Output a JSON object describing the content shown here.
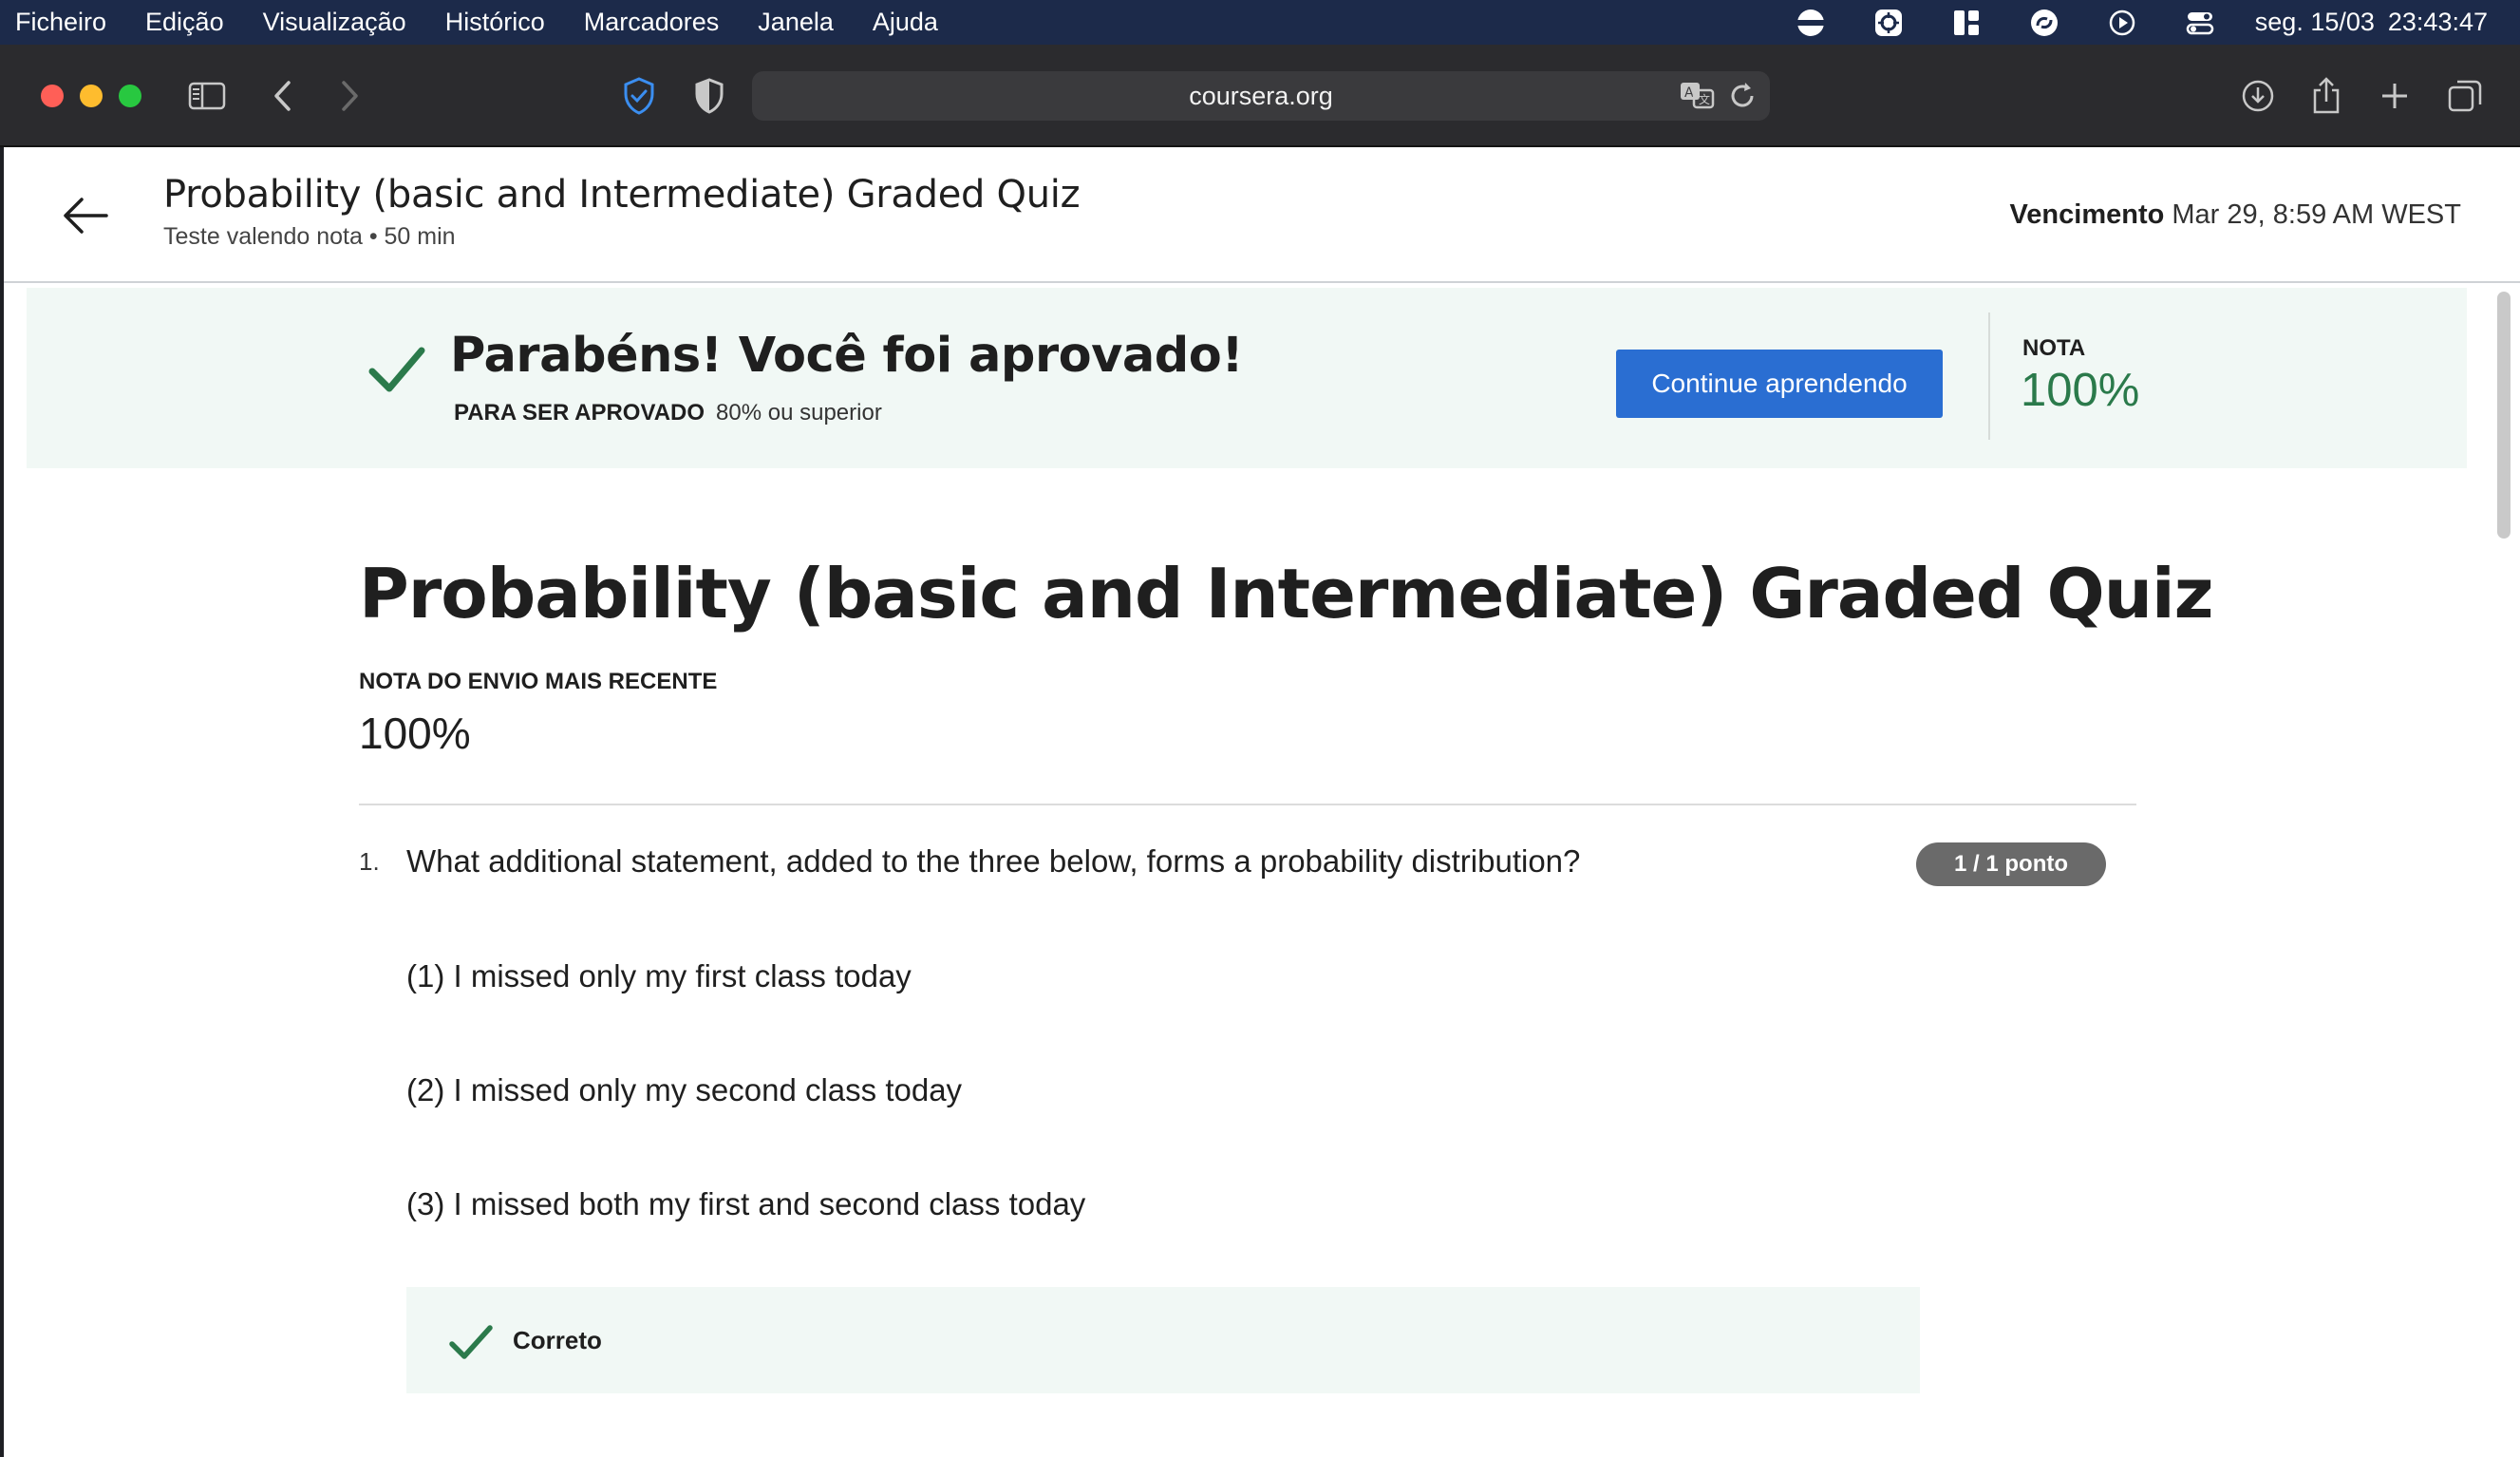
{
  "menubar": {
    "items": [
      "Ficheiro",
      "Edição",
      "Visualização",
      "Histórico",
      "Marcadores",
      "Janela",
      "Ajuda"
    ],
    "date": "seg. 15/03",
    "time": "23:43:47",
    "status_icons": [
      "vpn-icon",
      "focus-icon",
      "grid-app-icon",
      "swirl-app-icon",
      "play-icon",
      "control-center-icon"
    ]
  },
  "browser": {
    "url": "coursera.org",
    "colors": {
      "close": "#ff5f57",
      "minimize": "#febc2e",
      "zoom": "#28c840",
      "shield": "#3b8ef0"
    }
  },
  "header": {
    "title": "Probability (basic and Intermediate) Graded Quiz",
    "subtitle": "Teste valendo nota • 50 min",
    "due_label": "Vencimento",
    "due_value": "Mar 29, 8:59 AM WEST"
  },
  "banner": {
    "message": "Parabéns! Você foi aprovado!",
    "pass_label": "PARA SER APROVADO",
    "pass_value": "80% ou superior",
    "continue_label": "Continue aprendendo",
    "grade_label": "NOTA",
    "grade_value": "100%",
    "colors": {
      "background": "#f1f8f5",
      "grade": "#2b7a4b",
      "button": "#2a6ed2"
    }
  },
  "main": {
    "title": "Probability (basic and Intermediate) Graded Quiz",
    "recent_label": "NOTA DO ENVIO MAIS RECENTE",
    "recent_value": "100%",
    "question": {
      "number": "1.",
      "text": "What additional statement, added to the three below, forms a probability distribution?",
      "points": "1 / 1 ponto",
      "statements": [
        "(1) I missed only my first class today",
        "(2) I missed only my second class today",
        "(3) I missed both my first and second class today"
      ],
      "feedback": "Correto"
    }
  }
}
